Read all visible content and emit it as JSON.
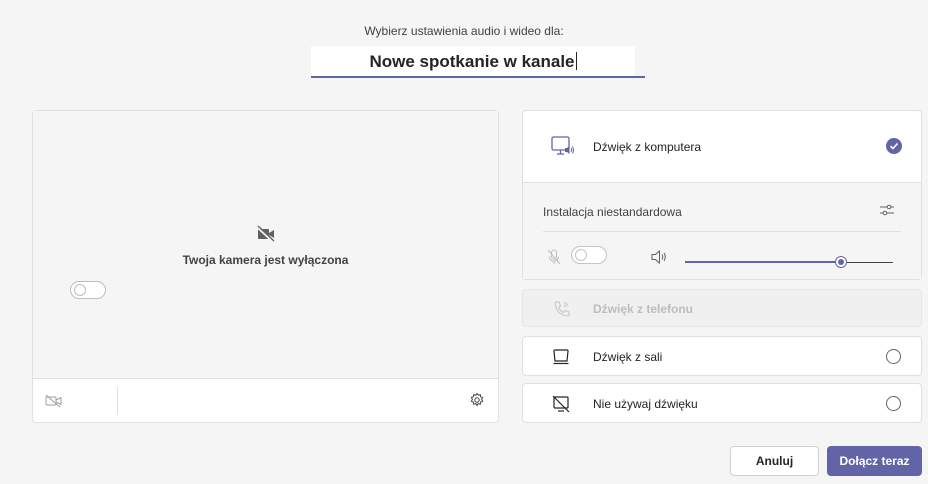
{
  "header": {
    "subtitle": "Wybierz ustawienia audio i wideo dla:",
    "meeting_title": "Nowe spotkanie w kanale"
  },
  "camera": {
    "off_text": "Twoja kamera jest wyłączona",
    "camera_toggle_on": false
  },
  "audio_options": {
    "computer": {
      "label": "Dźwięk z komputera",
      "selected": true,
      "custom_setup_label": "Instalacja niestandardowa",
      "mic_toggle_on": false,
      "speaker_volume": 0.75
    },
    "phone": {
      "label": "Dźwięk z telefonu",
      "disabled": true
    },
    "room": {
      "label": "Dźwięk z sali",
      "selected": false
    },
    "no_audio": {
      "label": "Nie używaj dźwięku",
      "selected": false
    }
  },
  "buttons": {
    "cancel": "Anuluj",
    "join": "Dołącz teraz"
  },
  "colors": {
    "accent": "#6264a7",
    "background": "#f5f5f5"
  },
  "icons": {
    "camera_off": "camera-off-icon",
    "computer_audio": "computer-audio-icon",
    "settings": "gear-icon",
    "phone": "phone-icon",
    "room": "room-device-icon",
    "no_audio": "no-audio-icon"
  }
}
